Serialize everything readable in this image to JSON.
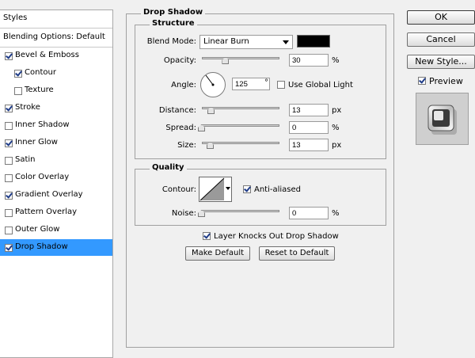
{
  "left_panel": {
    "styles_label": "Styles",
    "blending_label": "Blending Options: Default",
    "items": [
      {
        "label": "Bevel & Emboss",
        "checked": true
      },
      {
        "label": "Contour",
        "checked": true
      },
      {
        "label": "Texture",
        "checked": false
      },
      {
        "label": "Stroke",
        "checked": true
      },
      {
        "label": "Inner Shadow",
        "checked": false
      },
      {
        "label": "Inner Glow",
        "checked": true
      },
      {
        "label": "Satin",
        "checked": false
      },
      {
        "label": "Color Overlay",
        "checked": false
      },
      {
        "label": "Gradient Overlay",
        "checked": true
      },
      {
        "label": "Pattern Overlay",
        "checked": false
      },
      {
        "label": "Outer Glow",
        "checked": false
      },
      {
        "label": "Drop Shadow",
        "checked": true,
        "selected": true
      }
    ]
  },
  "drop_shadow": {
    "title": "Drop Shadow",
    "structure_title": "Structure",
    "blend_mode_label": "Blend Mode:",
    "blend_mode_value": "Linear Burn",
    "shadow_color": "#000000",
    "opacity_label": "Opacity:",
    "opacity_value": "30",
    "opacity_fraction": 0.3,
    "opacity_unit": "%",
    "angle_label": "Angle:",
    "angle_value": "125",
    "angle_unit": "°",
    "use_global_light_label": "Use Global Light",
    "use_global_light_checked": false,
    "distance_label": "Distance:",
    "distance_value": "13",
    "distance_unit": "px",
    "spread_label": "Spread:",
    "spread_value": "0",
    "spread_unit": "%",
    "size_label": "Size:",
    "size_value": "13",
    "size_unit": "px",
    "quality_title": "Quality",
    "contour_label": "Contour:",
    "anti_aliased_label": "Anti-aliased",
    "anti_aliased_checked": true,
    "noise_label": "Noise:",
    "noise_value": "0",
    "noise_unit": "%",
    "layer_knocks_label": "Layer Knocks Out Drop Shadow",
    "layer_knocks_checked": true,
    "make_default_label": "Make Default",
    "reset_default_label": "Reset to Default"
  },
  "right_panel": {
    "ok_label": "OK",
    "cancel_label": "Cancel",
    "new_style_label": "New Style...",
    "preview_label": "Preview",
    "preview_checked": true
  }
}
